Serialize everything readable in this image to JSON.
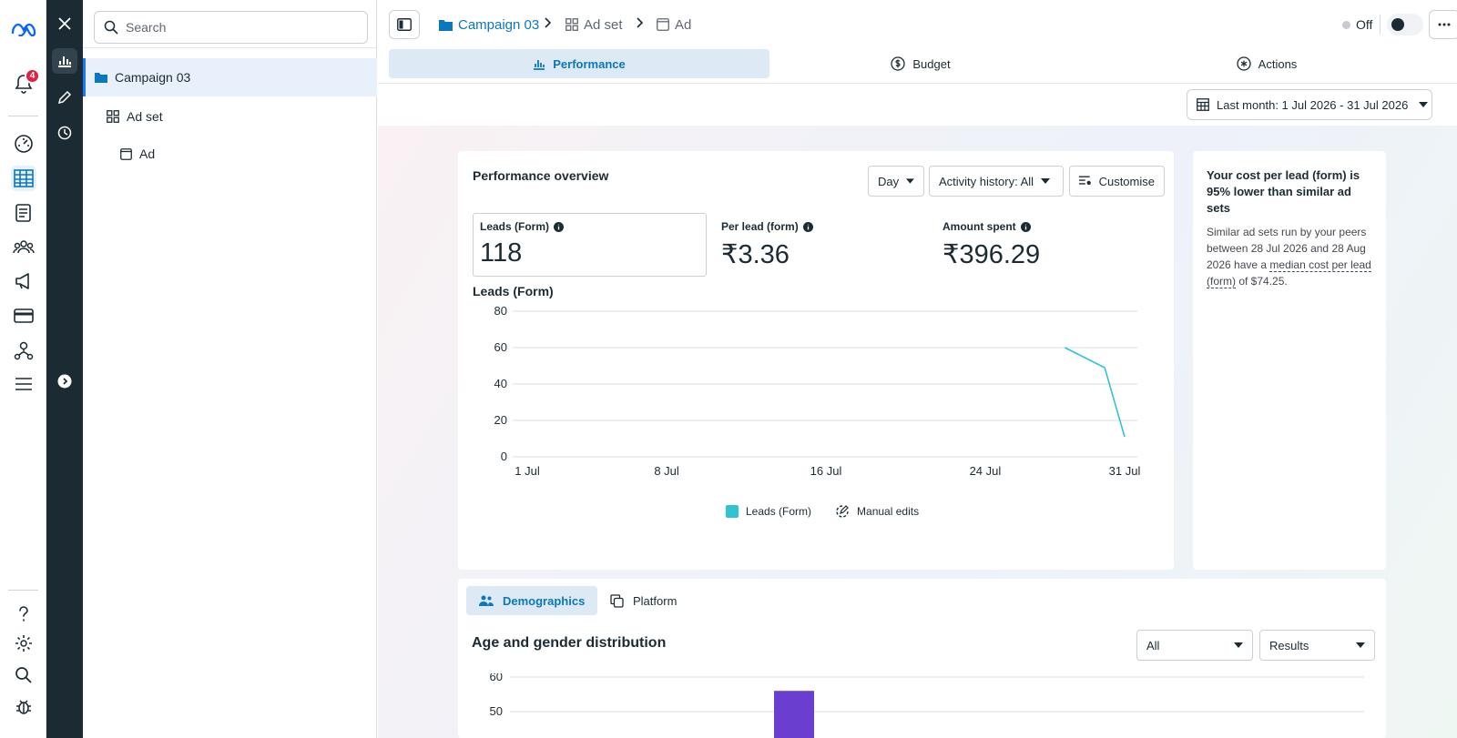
{
  "notifications": {
    "count": "4"
  },
  "tree": {
    "search_placeholder": "Search",
    "items": [
      {
        "label": "Campaign 03"
      },
      {
        "label": "Ad set"
      },
      {
        "label": "Ad"
      }
    ]
  },
  "breadcrumb": {
    "campaign": "Campaign 03",
    "adset": "Ad set",
    "ad": "Ad"
  },
  "status": {
    "label": "Off"
  },
  "tabs": [
    {
      "label": "Performance"
    },
    {
      "label": "Budget"
    },
    {
      "label": "Actions"
    }
  ],
  "date_range": {
    "label": "Last month: 1 Jul 2026 - 31 Jul 2026"
  },
  "overview": {
    "title": "Performance overview",
    "granularity": "Day",
    "activity": "Activity history: All",
    "customise": "Customise",
    "metrics": [
      {
        "label": "Leads (Form)",
        "value": "118"
      },
      {
        "label": "Per lead (form)",
        "value": "₹3.36"
      },
      {
        "label": "Amount spent",
        "value": "₹396.29"
      }
    ],
    "chart_title": "Leads (Form)",
    "legend": {
      "series": "Leads (Form)",
      "edits": "Manual edits"
    }
  },
  "insight": {
    "title": "Your cost per lead (form) is 95% lower than similar ad sets",
    "body_pre": "Similar ad sets run by your peers between 28 Jul 2026 and 28 Aug 2026 have a ",
    "body_link": "median cost per lead (form)",
    "body_post": " of $74.25."
  },
  "breakdown": {
    "tabs": [
      {
        "label": "Demographics"
      },
      {
        "label": "Platform"
      }
    ],
    "title": "Age and gender distribution",
    "filter_all": "All",
    "filter_results": "Results"
  },
  "colors": {
    "accent": "#0a78be",
    "series": "#2fc3d4",
    "bar": "#6a3fd0",
    "dark_rail": "#1c2b33"
  },
  "chart_data": [
    {
      "type": "line",
      "title": "Leads (Form)",
      "xlabel": "",
      "ylabel": "",
      "x_ticks": [
        "1 Jul",
        "8 Jul",
        "16 Jul",
        "24 Jul",
        "31 Jul"
      ],
      "ylim": [
        0,
        80
      ],
      "y_ticks": [
        0,
        20,
        40,
        60,
        80
      ],
      "grid": true,
      "legend": "bottom",
      "series": [
        {
          "name": "Leads (Form)",
          "x": [
            "28 Jul",
            "30 Jul",
            "31 Jul"
          ],
          "y": [
            60,
            49,
            11
          ]
        }
      ]
    },
    {
      "type": "bar",
      "title": "Age and gender distribution",
      "ylim": [
        0,
        60
      ],
      "y_ticks": [
        50,
        60
      ],
      "grid": true,
      "values": [
        56
      ]
    }
  ]
}
